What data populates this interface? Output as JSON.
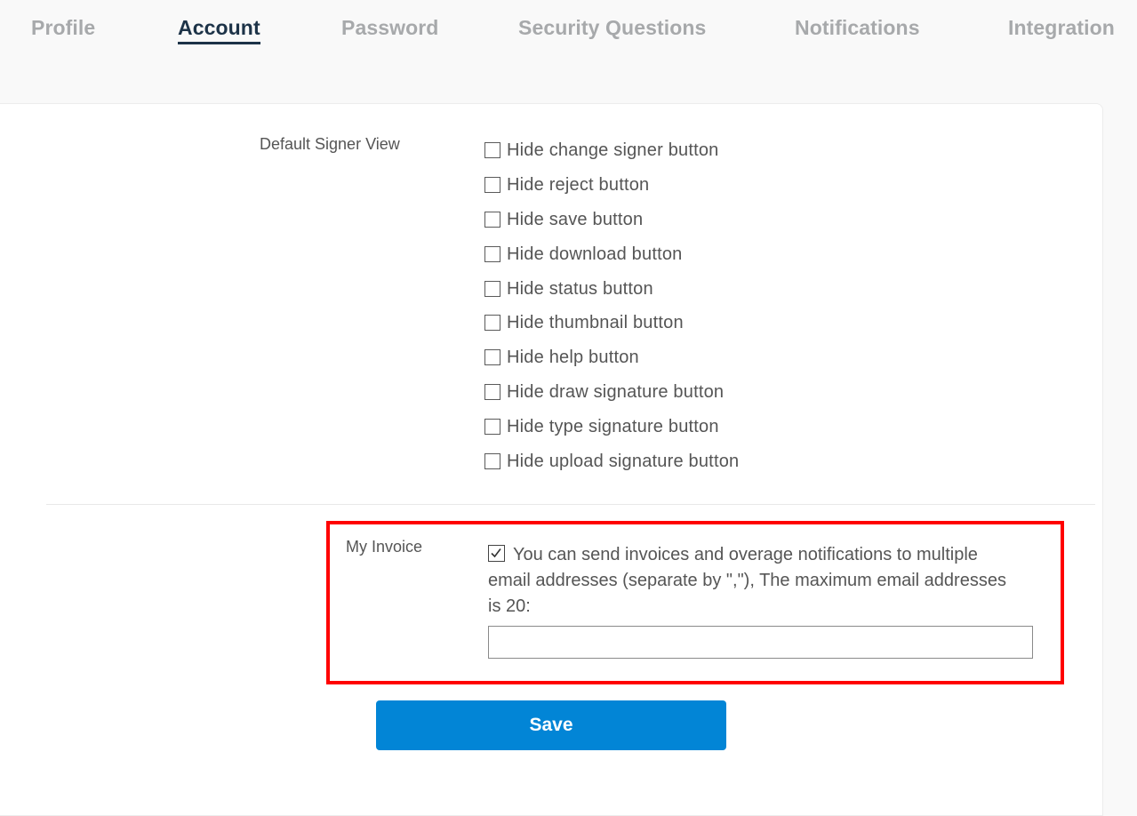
{
  "tabs": [
    {
      "label": "Profile",
      "active": false
    },
    {
      "label": "Account",
      "active": true
    },
    {
      "label": "Password",
      "active": false
    },
    {
      "label": "Security Questions",
      "active": false
    },
    {
      "label": "Notifications",
      "active": false
    },
    {
      "label": "Integration",
      "active": false
    }
  ],
  "signer_view": {
    "label": "Default Signer View",
    "options": [
      {
        "label": "Hide change signer button",
        "checked": false
      },
      {
        "label": "Hide reject button",
        "checked": false
      },
      {
        "label": "Hide save button",
        "checked": false
      },
      {
        "label": "Hide download button",
        "checked": false
      },
      {
        "label": "Hide status button",
        "checked": false
      },
      {
        "label": "Hide thumbnail button",
        "checked": false
      },
      {
        "label": "Hide help button",
        "checked": false
      },
      {
        "label": "Hide draw signature button",
        "checked": false
      },
      {
        "label": "Hide type signature button",
        "checked": false
      },
      {
        "label": "Hide upload signature button",
        "checked": false
      }
    ]
  },
  "invoice": {
    "label": "My Invoice",
    "checked": true,
    "description": "You can send invoices and overage notifications to multiple email addresses (separate by \",\"), The maximum email addresses is 20:",
    "email_value": "",
    "email_placeholder": ""
  },
  "save_label": "Save",
  "colors": {
    "active_tab": "#1d3348",
    "inactive_tab": "#a7a9ab",
    "primary_button": "#0285d6",
    "highlight_border": "#ff0000"
  }
}
